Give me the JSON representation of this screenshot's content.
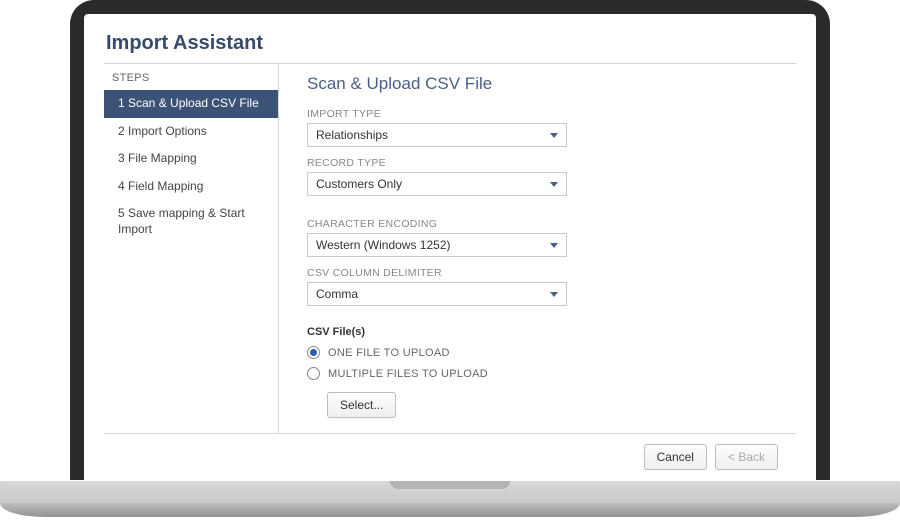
{
  "title": "Import Assistant",
  "sidebar": {
    "heading": "STEPS",
    "items": [
      {
        "label": "1 Scan & Upload CSV File",
        "active": true
      },
      {
        "label": "2 Import Options",
        "active": false
      },
      {
        "label": "3 File Mapping",
        "active": false
      },
      {
        "label": "4 Field Mapping",
        "active": false
      },
      {
        "label": "5 Save mapping & Start Import",
        "active": false
      }
    ]
  },
  "main": {
    "page_title": "Scan & Upload CSV File",
    "import_type_label": "IMPORT TYPE",
    "import_type_value": "Relationships",
    "record_type_label": "RECORD TYPE",
    "record_type_value": "Customers Only",
    "char_encoding_label": "CHARACTER ENCODING",
    "char_encoding_value": "Western (Windows 1252)",
    "delimiter_label": "CSV COLUMN DELIMITER",
    "delimiter_value": "Comma",
    "csv_files_label": "CSV File(s)",
    "radio_one_label": "ONE FILE TO UPLOAD",
    "radio_multi_label": "MULTIPLE FILES TO UPLOAD",
    "radio_selected": "one",
    "select_button": "Select..."
  },
  "footer": {
    "cancel": "Cancel",
    "back": "< Back"
  }
}
